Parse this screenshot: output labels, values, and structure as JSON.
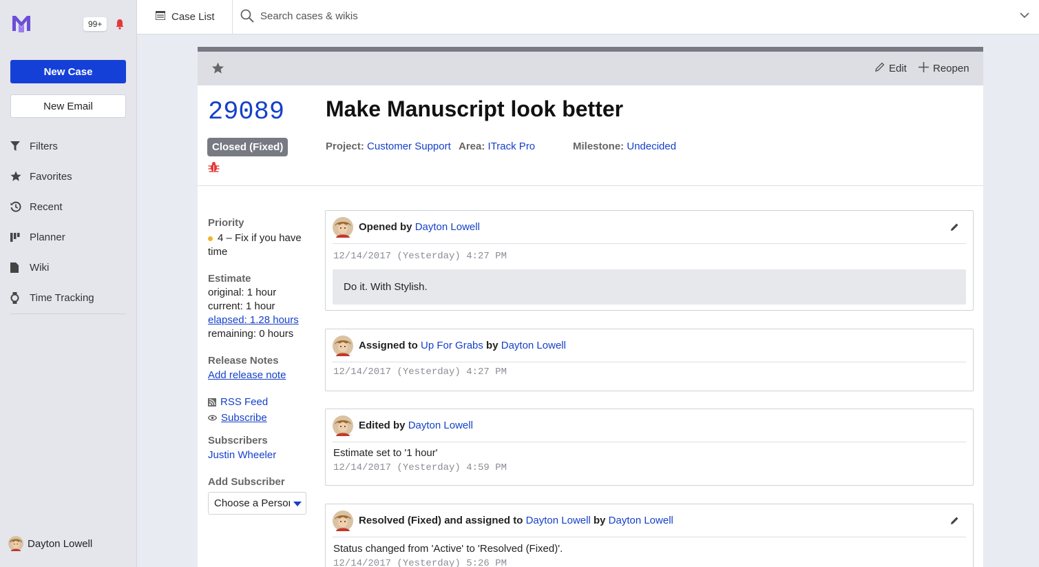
{
  "sidebar": {
    "notification_count": "99+",
    "new_case_label": "New Case",
    "new_email_label": "New Email",
    "nav": [
      {
        "label": "Filters",
        "icon": "filter-icon"
      },
      {
        "label": "Favorites",
        "icon": "star-icon"
      },
      {
        "label": "Recent",
        "icon": "history-icon"
      },
      {
        "label": "Planner",
        "icon": "planner-icon"
      },
      {
        "label": "Wiki",
        "icon": "document-icon"
      },
      {
        "label": "Time Tracking",
        "icon": "watch-icon"
      }
    ],
    "user_name": "Dayton Lowell"
  },
  "topbar": {
    "case_list_label": "Case List",
    "search_placeholder": "Search cases & wikis"
  },
  "case": {
    "toolbar": {
      "edit_label": "Edit",
      "reopen_label": "Reopen"
    },
    "number": "29089",
    "status": "Closed (Fixed)",
    "title": "Make Manuscript look better",
    "project_label": "Project:",
    "project": "Customer Support",
    "area_label": "Area:",
    "area": "ITrack Pro",
    "milestone_label": "Milestone:",
    "milestone": "Undecided"
  },
  "details": {
    "priority_label": "Priority",
    "priority_value": "4 – Fix if you have time",
    "estimate_label": "Estimate",
    "original": "original: 1 hour",
    "current": "current: 1 hour",
    "elapsed": "elapsed: 1.28 hours",
    "remaining": "remaining: 0 hours",
    "release_notes_label": "Release Notes",
    "add_release_note": "Add release note",
    "rss_feed": "RSS Feed",
    "subscribe": "Subscribe",
    "subscribers_label": "Subscribers",
    "subscriber": "Justin Wheeler",
    "add_subscriber_label": "Add Subscriber",
    "choose_person": "Choose a Person"
  },
  "events": [
    {
      "action": "Opened by",
      "by": "Dayton Lowell",
      "time": "12/14/2017 (Yesterday) 4:27 PM",
      "body": "Do it. With Stylish."
    },
    {
      "action": "Assigned to",
      "target": "Up For Grabs",
      "by_label": "by",
      "by": "Dayton Lowell",
      "time": "12/14/2017 (Yesterday) 4:27 PM"
    },
    {
      "action": "Edited by",
      "by": "Dayton Lowell",
      "text": "Estimate set to '1 hour'",
      "time": "12/14/2017 (Yesterday) 4:59 PM"
    },
    {
      "action": "Resolved (Fixed) and assigned to",
      "target": "Dayton Lowell",
      "by_label": "by",
      "by": "Dayton Lowell",
      "text": "Status changed from 'Active' to 'Resolved (Fixed)'.",
      "time": "12/14/2017 (Yesterday) 5:26 PM"
    }
  ],
  "colors": {
    "accent": "#1540d8",
    "link": "#1540c8",
    "status_badge": "#777a82",
    "priority_dot": "#f0b52c",
    "bug": "#e53935"
  }
}
